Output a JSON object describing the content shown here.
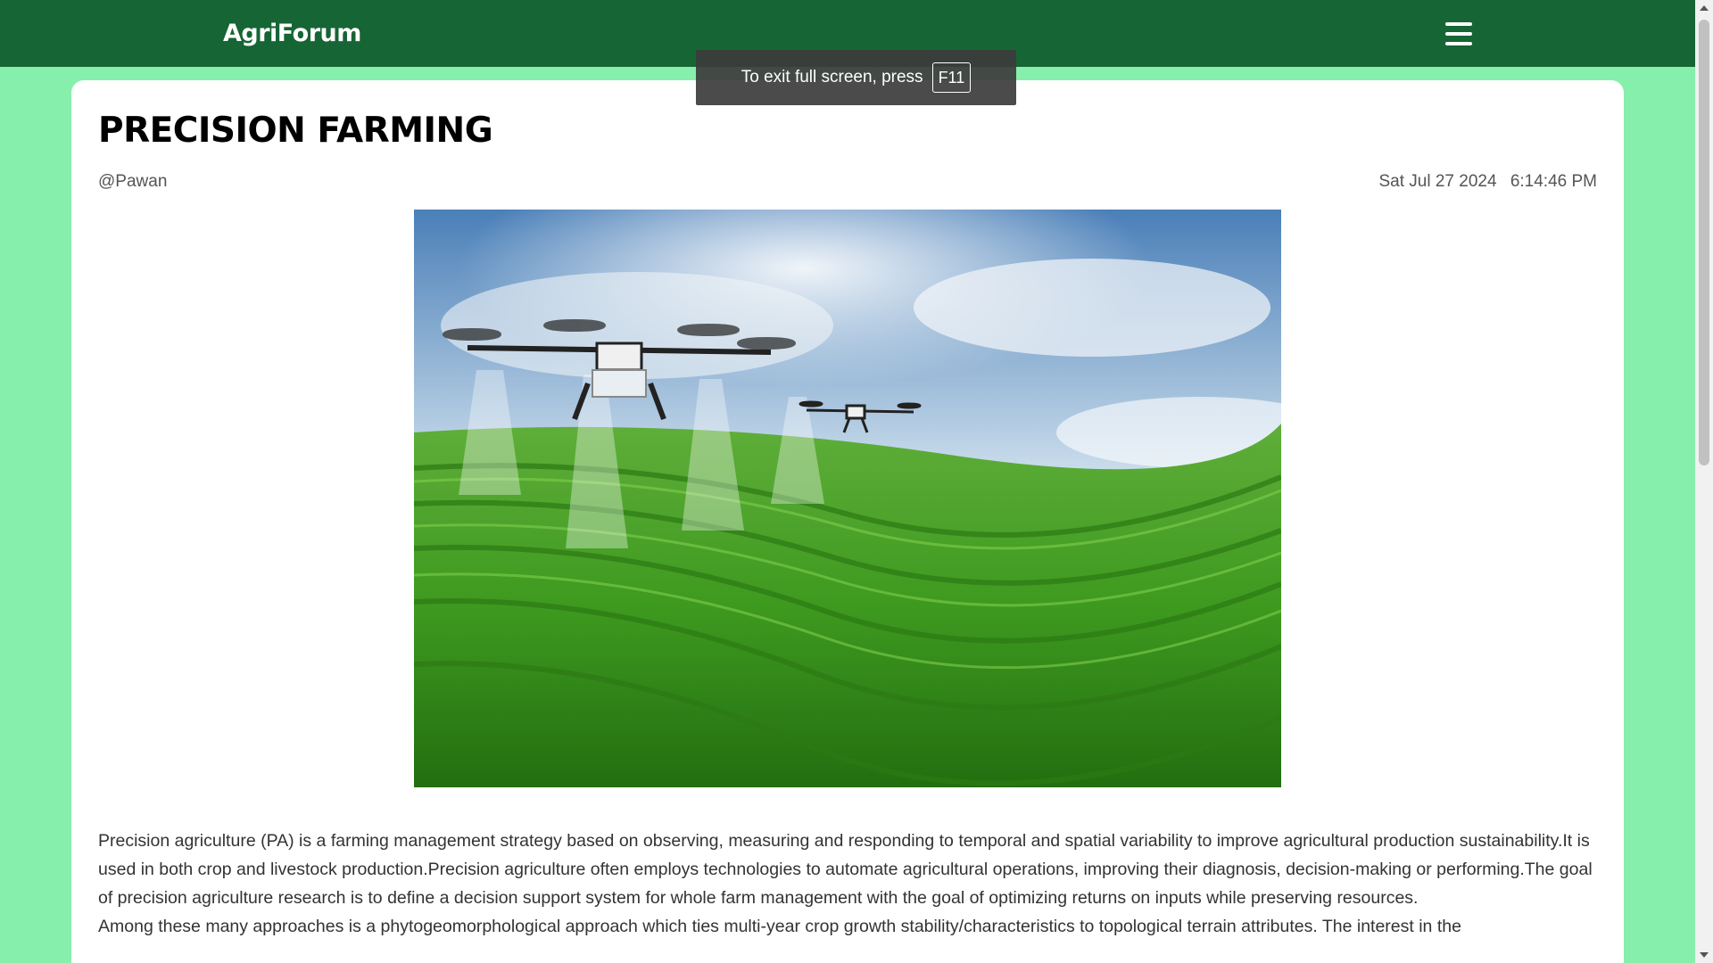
{
  "navbar": {
    "brand": "AgriForum",
    "menu_icon": "hamburger-menu-icon",
    "background": "#166534"
  },
  "fullscreen_notice": {
    "text": "To exit full screen, press",
    "key": "F11"
  },
  "post": {
    "title": "PRECISION FARMING",
    "author": "@Pawan",
    "date": "Sat Jul 27 2024",
    "time": "6:14:46 PM",
    "image_alt": "Drones spraying a green tea plantation",
    "paragraphs": [
      "Precision agriculture (PA) is a farming management strategy based on observing, measuring and responding to temporal and spatial variability to improve agricultural production sustainability.It is used in both crop and livestock production.Precision agriculture often employs technologies to automate agricultural operations, improving their diagnosis, decision-making or performing.The goal of precision agriculture research is to define a decision support system for whole farm management with the goal of optimizing returns on inputs while preserving resources.",
      "Among these many approaches is a phytogeomorphological approach which ties multi-year crop growth stability/characteristics to topological terrain attributes. The interest in the"
    ]
  },
  "colors": {
    "page_background": "#86efac",
    "card_background": "#ffffff"
  }
}
